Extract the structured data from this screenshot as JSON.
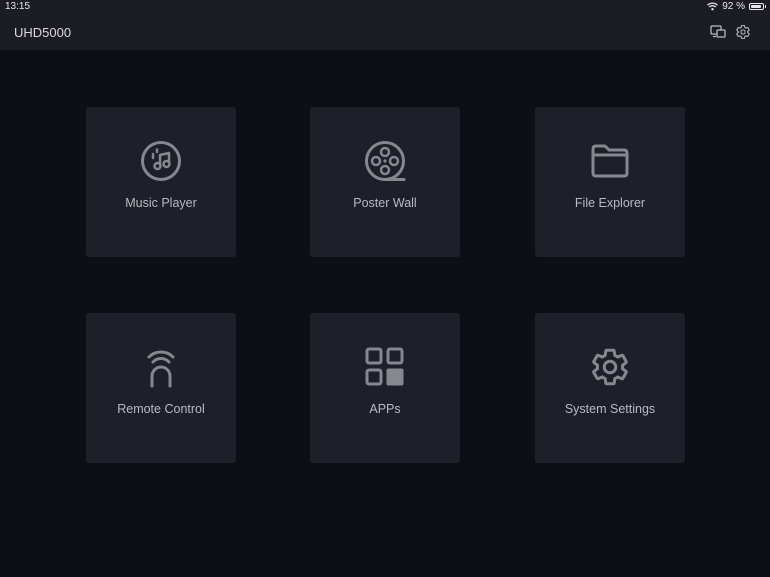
{
  "status": {
    "time": "13:15",
    "battery_text": "92 %",
    "battery_level": 0.92,
    "icons": [
      "wifi-icon",
      "battery-icon"
    ]
  },
  "header": {
    "title": "UHD5000",
    "actions": [
      {
        "icon": "screen-mirror-icon"
      },
      {
        "icon": "gear-icon"
      }
    ]
  },
  "tiles": [
    {
      "label": "Music Player",
      "icon": "music-disc-icon"
    },
    {
      "label": "Poster Wall",
      "icon": "film-reel-icon"
    },
    {
      "label": "File Explorer",
      "icon": "folder-icon"
    },
    {
      "label": "Remote Control",
      "icon": "remote-signal-icon"
    },
    {
      "label": "APPs",
      "icon": "apps-grid-icon"
    },
    {
      "label": "System Settings",
      "icon": "gear-icon"
    }
  ],
  "colors": {
    "background": "#0d0e16",
    "bar": "#1b1c24",
    "tile": "#1e1f29",
    "icon": "#86878f",
    "text": "#b9bac2"
  }
}
